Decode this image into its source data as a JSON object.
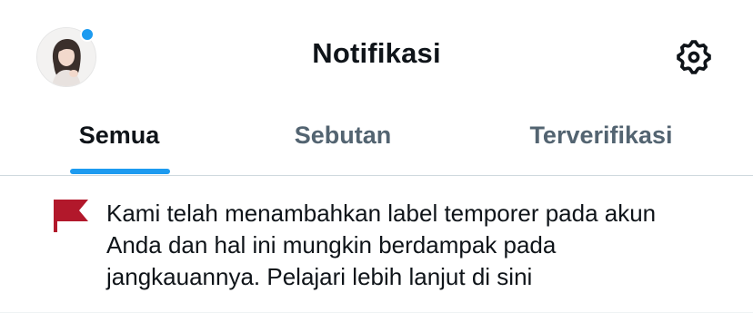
{
  "header": {
    "title": "Notifikasi",
    "avatar_icon": "user-avatar",
    "notification_dot_color": "#1d9bf0",
    "settings_icon": "gear-icon"
  },
  "tabs": [
    {
      "label": "Semua",
      "active": true
    },
    {
      "label": "Sebutan",
      "active": false
    },
    {
      "label": "Terverifikasi",
      "active": false
    }
  ],
  "notice": {
    "icon": "flag-icon",
    "icon_color": "#b2182b",
    "lines": [
      "Kami telah menambahkan label temporer pada akun",
      "Anda dan hal ini mungkin berdampak pada",
      "jangkauannya. Pelajari lebih lanjut di sini"
    ]
  },
  "colors": {
    "accent": "#1d9bf0",
    "text_primary": "#0f1419",
    "text_secondary": "#536471",
    "divider": "#cfd9de"
  }
}
